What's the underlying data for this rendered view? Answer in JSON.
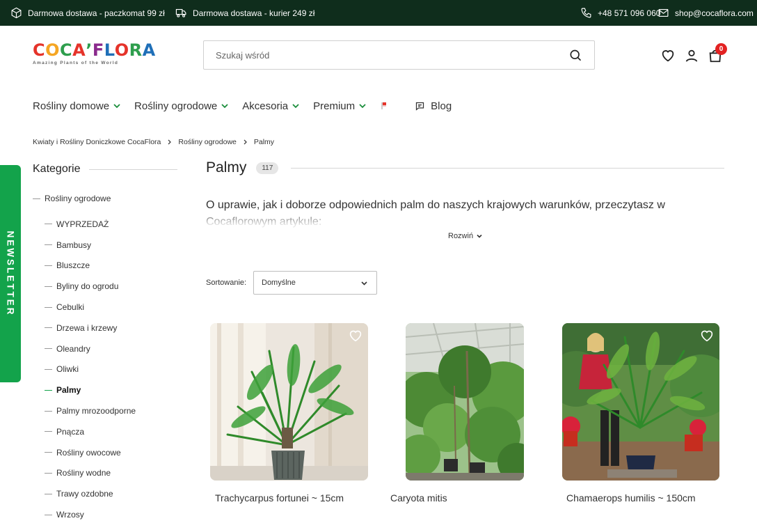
{
  "topbar": {
    "shipping_parcel": "Darmowa dostawa - paczkomat 99 zł",
    "shipping_courier": "Darmowa dostawa - kurier 249 zł",
    "phone": "+48 571 096 060",
    "email": "shop@cocaflora.com"
  },
  "logo": {
    "letters": [
      "C",
      "O",
      "C",
      "A",
      "ʼ",
      "F",
      "L",
      "O",
      "R",
      "A"
    ],
    "colors": [
      "#e5332a",
      "#f5a623",
      "#2e9e4d",
      "#e5332a",
      "#2e9e4d",
      "#8a2a8c",
      "#1f6fb8",
      "#e5332a",
      "#2e9e4d",
      "#1f6fb8"
    ],
    "tagline": "Amazing Plants of the World"
  },
  "search": {
    "placeholder": "Szukaj wśród"
  },
  "cart": {
    "count": "0"
  },
  "nav": {
    "items": [
      "Rośliny domowe",
      "Rośliny ogrodowe",
      "Akcesoria",
      "Premium"
    ],
    "blog": "Blog"
  },
  "breadcrumb": [
    "Kwiaty i Rośliny Doniczkowe CocaFlora",
    "Rośliny ogrodowe",
    "Palmy"
  ],
  "newsletter": {
    "label": "NEWSLETTER"
  },
  "sidebar": {
    "title": "Kategorie",
    "root": "Rośliny ogrodowe",
    "items": [
      "WYPRZEDAŻ",
      "Bambusy",
      "Bluszcze",
      "Byliny do ogrodu",
      "Cebulki",
      "Drzewa i krzewy",
      "Oleandry",
      "Oliwki",
      "Palmy",
      "Palmy mrozoodporne",
      "Pnącza",
      "Rośliny owocowe",
      "Rośliny wodne",
      "Trawy ozdobne",
      "Wrzosy"
    ],
    "active": "Palmy"
  },
  "main": {
    "title": "Palmy",
    "count": "117",
    "description": "O uprawie, jak i doborze odpowiednich palm do naszych krajowych warunków, przeczytasz w Cocaflorowym artykule:",
    "expand": "Rozwiń",
    "sort_label": "Sortowanie:",
    "sort_value": "Domyślne"
  },
  "products": [
    {
      "name": "Trachycarpus fortunei ~ 15cm"
    },
    {
      "name": "Caryota mitis"
    },
    {
      "name": "Chamaerops humilis ~ 150cm"
    }
  ],
  "colors": {
    "topbar": "#0f2d1c",
    "accent": "#13a34b",
    "badge": "#e32222"
  }
}
